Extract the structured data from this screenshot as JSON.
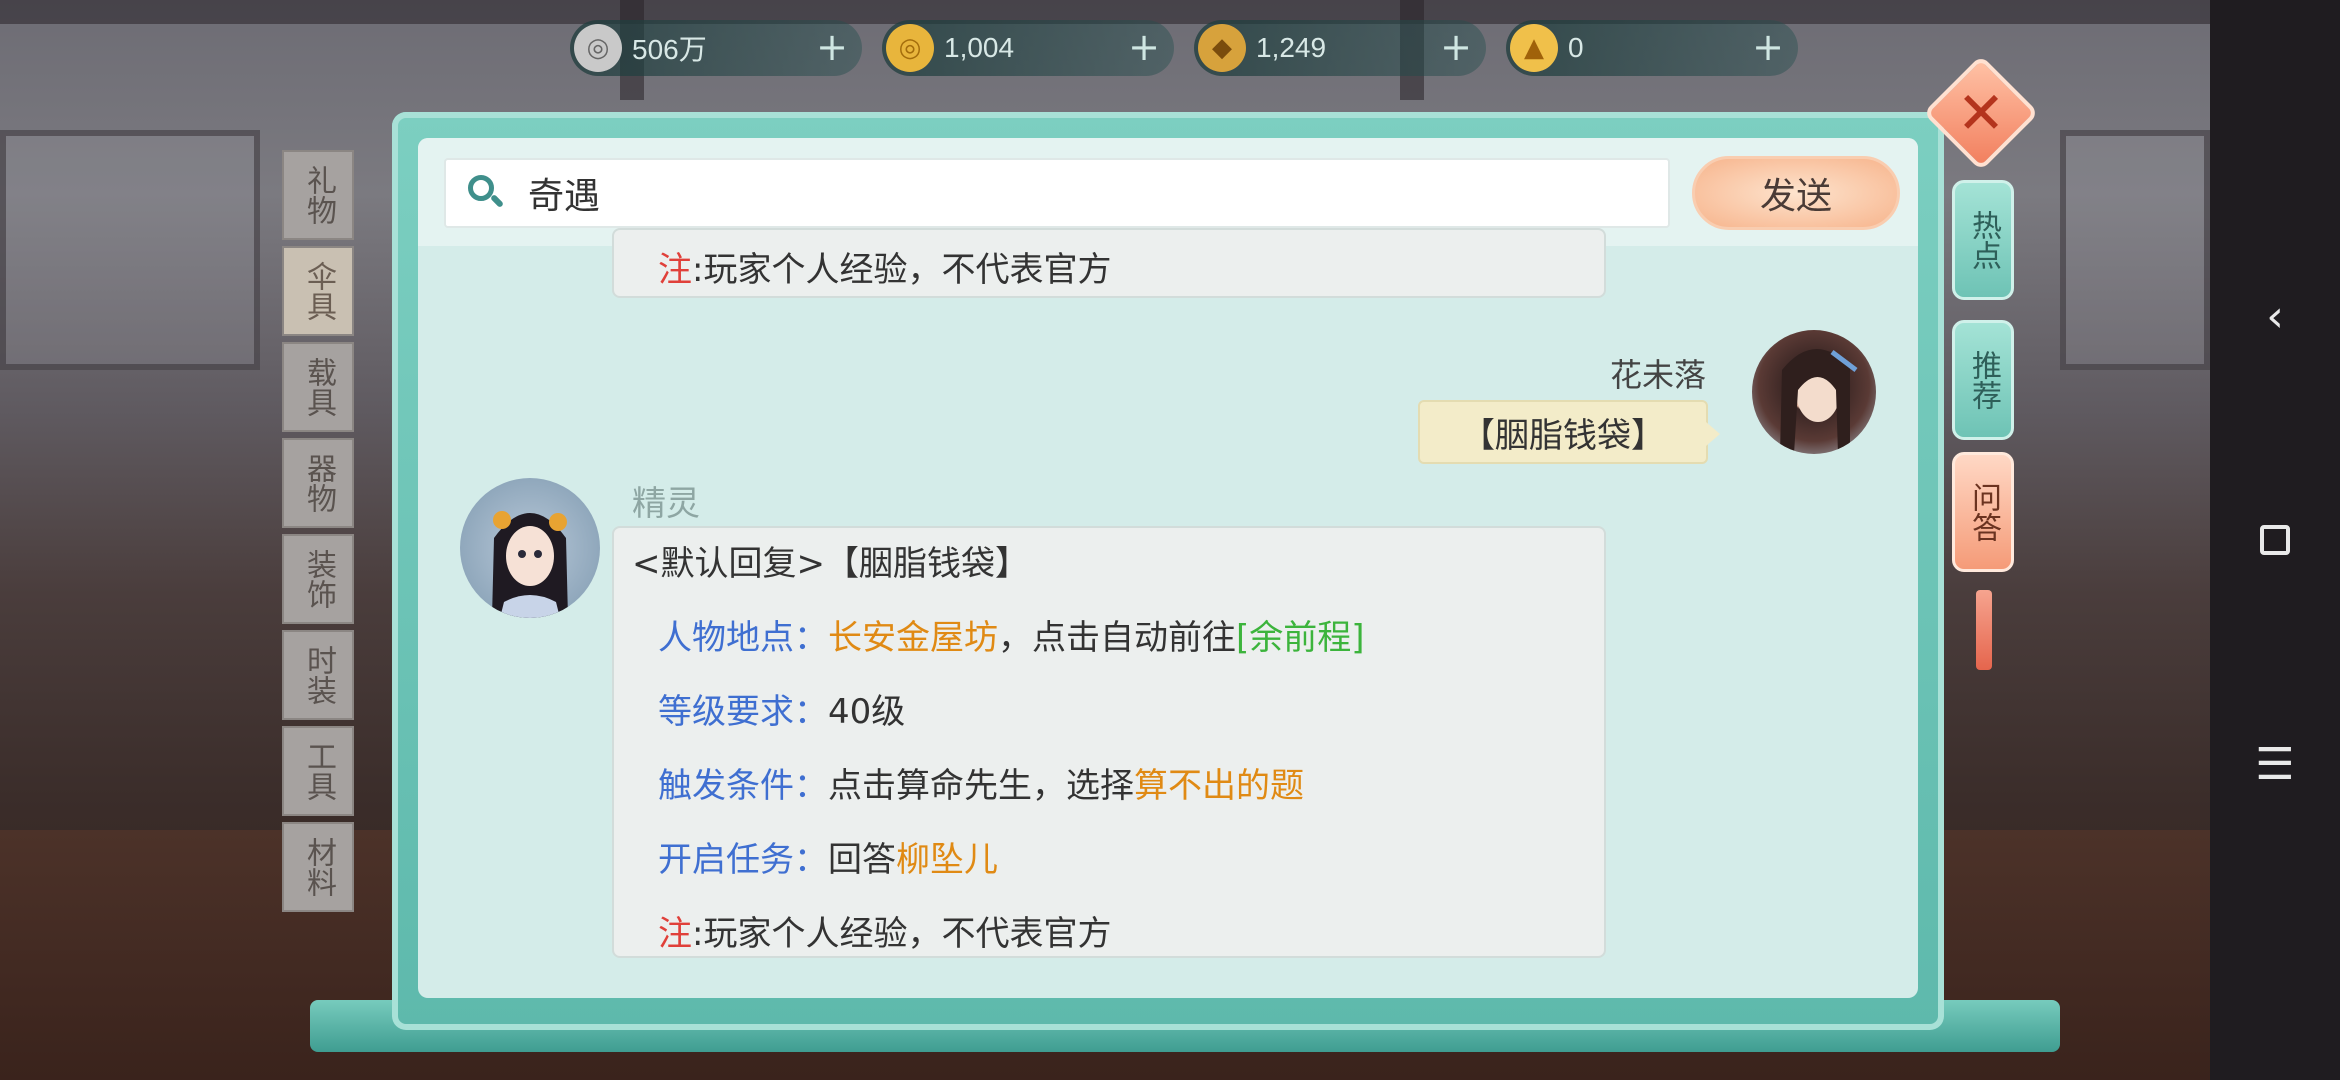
{
  "currencies": [
    {
      "icon": "silver-coin-icon",
      "value": "506万"
    },
    {
      "icon": "gold-coin-icon",
      "value": "1,004"
    },
    {
      "icon": "silver-ingot-icon",
      "value": "1,249"
    },
    {
      "icon": "gold-ingot-icon",
      "value": "0"
    }
  ],
  "side_tabs": [
    "礼物",
    "伞具",
    "载具",
    "器物",
    "装饰",
    "时装",
    "工具",
    "材料"
  ],
  "search": {
    "value": "奇遇",
    "send_label": "发送"
  },
  "chat": {
    "prev_note": {
      "label": "注",
      "text": ":玩家个人经验，不代表官方"
    },
    "player": {
      "name": "花未落",
      "message": "【胭脂钱袋】"
    },
    "npc": {
      "name": "精灵",
      "header": "<默认回复>【胭脂钱袋】",
      "location_label": "人物地点：",
      "location_value": "长安金屋坊",
      "location_mid": "，点击自动前往",
      "location_link": "[余前程]",
      "level_label": "等级要求：",
      "level_value": "40级",
      "trigger_label": "触发条件：",
      "trigger_text": "点击算命先生，选择",
      "trigger_value": "算不出的题",
      "quest_label": "开启任务：",
      "quest_text": "回答",
      "quest_value": "柳坠儿",
      "note_label": "注",
      "note_text": ":玩家个人经验，不代表官方"
    }
  },
  "right_tabs": [
    {
      "label": "热点",
      "active": false
    },
    {
      "label": "推荐",
      "active": false
    },
    {
      "label": "问答",
      "active": true
    }
  ],
  "colors": {
    "label_blue": "#3f6fd1",
    "value_orange": "#e08a14",
    "link_green": "#3cb43c",
    "note_red": "#e0403a",
    "frame_teal": "#7ccfc1"
  },
  "system_nav": [
    "back-icon",
    "recent-apps-icon",
    "menu-icon"
  ]
}
